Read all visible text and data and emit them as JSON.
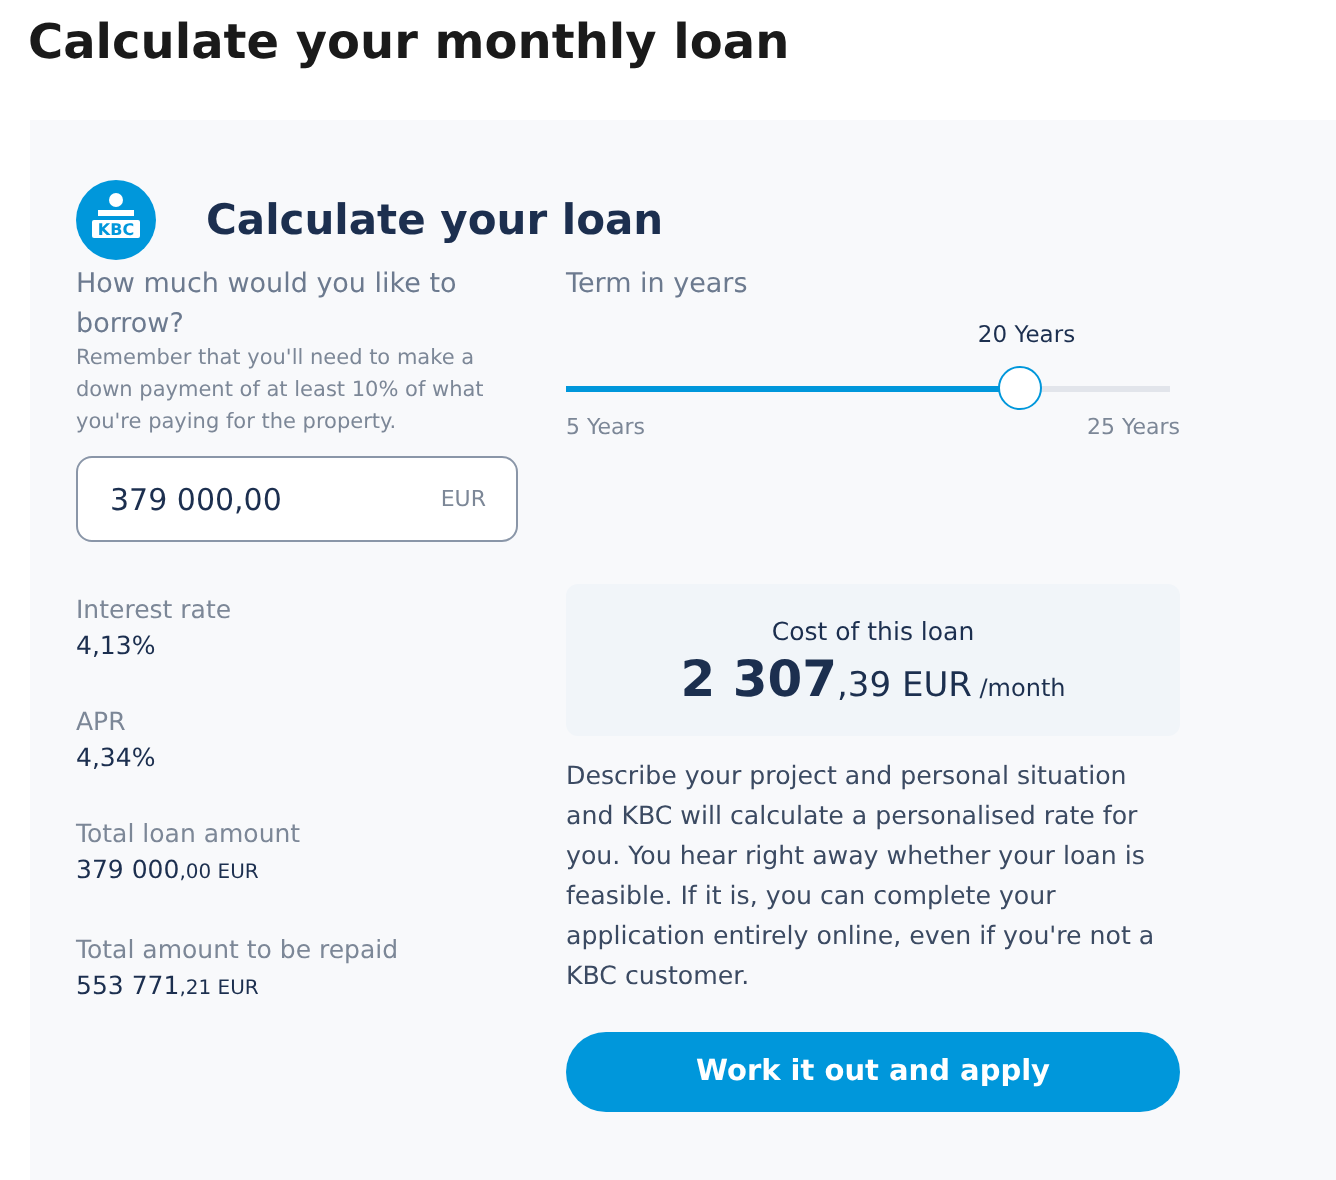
{
  "page_title": "Calculate your monthly loan",
  "card": {
    "logo_text": "KBC",
    "title": "Calculate your loan",
    "borrow": {
      "label": "How much would you like to borrow?",
      "hint": "Remember that you'll need to make a down payment of at least 10% of what you're paying for the property.",
      "value": "379 000,00",
      "unit": "EUR"
    },
    "term": {
      "label": "Term in years",
      "reading": "20 Years",
      "level": 0.75,
      "min_label": "5 Years",
      "max_label": "25 Years"
    },
    "stats": [
      {
        "label": "Interest rate",
        "value_main": "4,13%"
      },
      {
        "label": "APR",
        "value_main": "4,34%"
      },
      {
        "label": "Total loan amount",
        "value_main": "379 000",
        "value_small": ",00 EUR"
      },
      {
        "label": "Total amount to be repaid",
        "value_main": "553 771",
        "value_small": ",21 EUR"
      }
    ],
    "cost": {
      "label": "Cost of this loan",
      "amount_main": "2 307",
      "amount_small": ",39 EUR",
      "per": "/month"
    },
    "description": "Describe your project and personal situation and KBC will calculate a personalised rate for you. You hear right away whether your loan is feasible. If it is, you can complete your application entirely online, even if you're not a KBC customer.",
    "button": "Work it out and apply"
  }
}
